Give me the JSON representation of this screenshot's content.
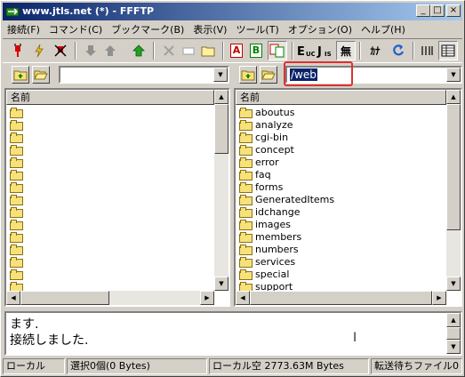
{
  "window": {
    "title": "www.jtls.net (*) - FFFTP"
  },
  "titlebar_buttons": {
    "minimize": "_",
    "maximize": "□",
    "close": "×"
  },
  "menu": [
    "接続(F)",
    "コマンド(C)",
    "ブックマーク(B)",
    "表示(V)",
    "ツール(T)",
    "オプション(O)",
    "ヘルプ(H)"
  ],
  "toolbar": {
    "ascii": "A",
    "binary": "B",
    "katakana": "ｶﾅ",
    "no_conv": "無"
  },
  "local": {
    "path": "",
    "column_header": "名前",
    "row_count": 15
  },
  "remote": {
    "path": "/web",
    "column_header": "名前",
    "items": [
      "aboutus",
      "analyze",
      "cgi-bin",
      "concept",
      "error",
      "faq",
      "forms",
      "GeneratedItems",
      "idchange",
      "images",
      "members",
      "numbers",
      "services",
      "special",
      "support"
    ]
  },
  "log": {
    "lines": [
      "ます.",
      "接続しました."
    ]
  },
  "status": {
    "mode": "ローカル",
    "selection": "選択0個(0 Bytes)",
    "local_free": "ローカル空 2773.63M Bytes",
    "queue": "転送待ちファイル0"
  },
  "colors": {
    "title_start": "#0a246a",
    "title_end": "#a6caf0",
    "highlight": "#e03030",
    "folder": "#f7e27a"
  }
}
